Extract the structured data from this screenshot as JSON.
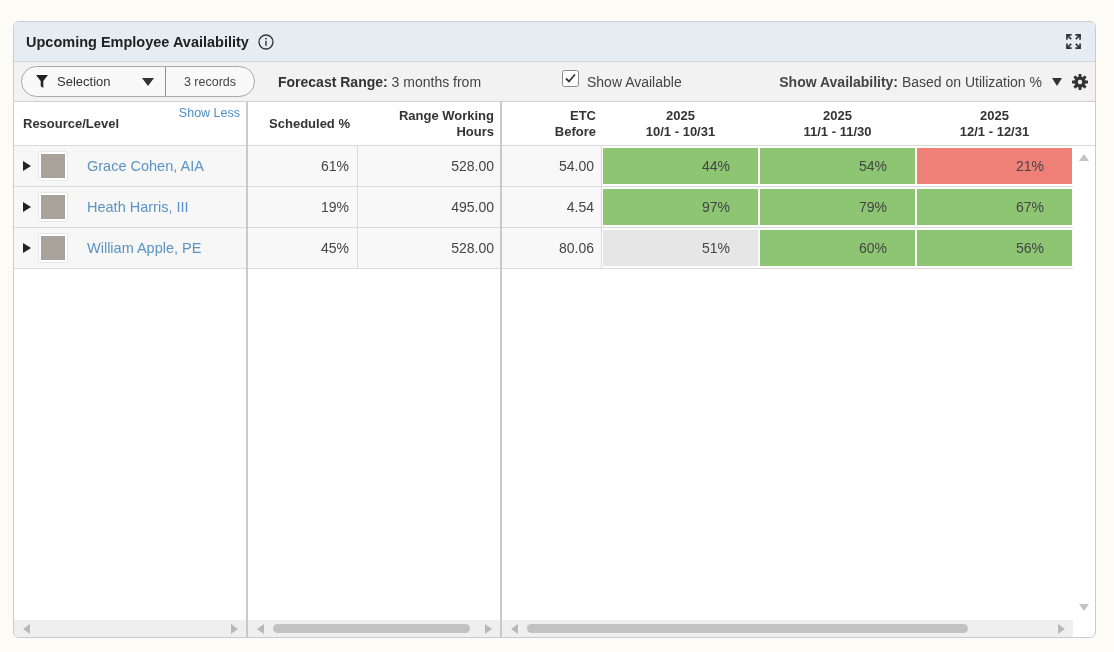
{
  "panel": {
    "title": "Upcoming Employee Availability"
  },
  "toolbar": {
    "filter": {
      "label": "Selection"
    },
    "record_count": "3 records",
    "forecast_range": "**Forecast Range:** 3 months from",
    "show_available": {
      "label": "Show Available",
      "checked": true
    },
    "show_availability": "**Show Availability:** Based on Utilization %"
  },
  "table": {
    "resource_header": "Resource/Level",
    "show_less": "Show Less",
    "middle_columns": [
      "Scheduled %",
      "Range Working Hours"
    ],
    "etc_header": "ETC Before",
    "periods": [
      {
        "year": "2025",
        "range": "10/1 - 10/31"
      },
      {
        "year": "2025",
        "range": "11/1 - 11/30"
      },
      {
        "year": "2025",
        "range": "12/1 - 12/31"
      }
    ],
    "rows": [
      {
        "name": "Grace Cohen, AIA",
        "expanded": false,
        "scheduled": "61%",
        "range_working_hours": "528.00",
        "etc_before": "54.00",
        "availability": [
          {
            "value": "44%",
            "color": "#8dc572"
          },
          {
            "value": "54%",
            "color": "#8dc572"
          },
          {
            "value": "21%",
            "color": "#ee8078"
          }
        ]
      },
      {
        "name": "Heath Harris, III",
        "expanded": false,
        "scheduled": "19%",
        "range_working_hours": "495.00",
        "etc_before": "4.54",
        "availability": [
          {
            "value": "97%",
            "color": "#8dc572"
          },
          {
            "value": "79%",
            "color": "#8dc572"
          },
          {
            "value": "67%",
            "color": "#8dc572"
          }
        ]
      },
      {
        "name": "William Apple, PE",
        "expanded": false,
        "scheduled": "45%",
        "range_working_hours": "528.00",
        "etc_before": "80.06",
        "availability": [
          {
            "value": "51%",
            "color": "#e6e6e6"
          },
          {
            "value": "60%",
            "color": "#8dc572"
          },
          {
            "value": "56%",
            "color": "#8dc572"
          }
        ]
      }
    ]
  }
}
